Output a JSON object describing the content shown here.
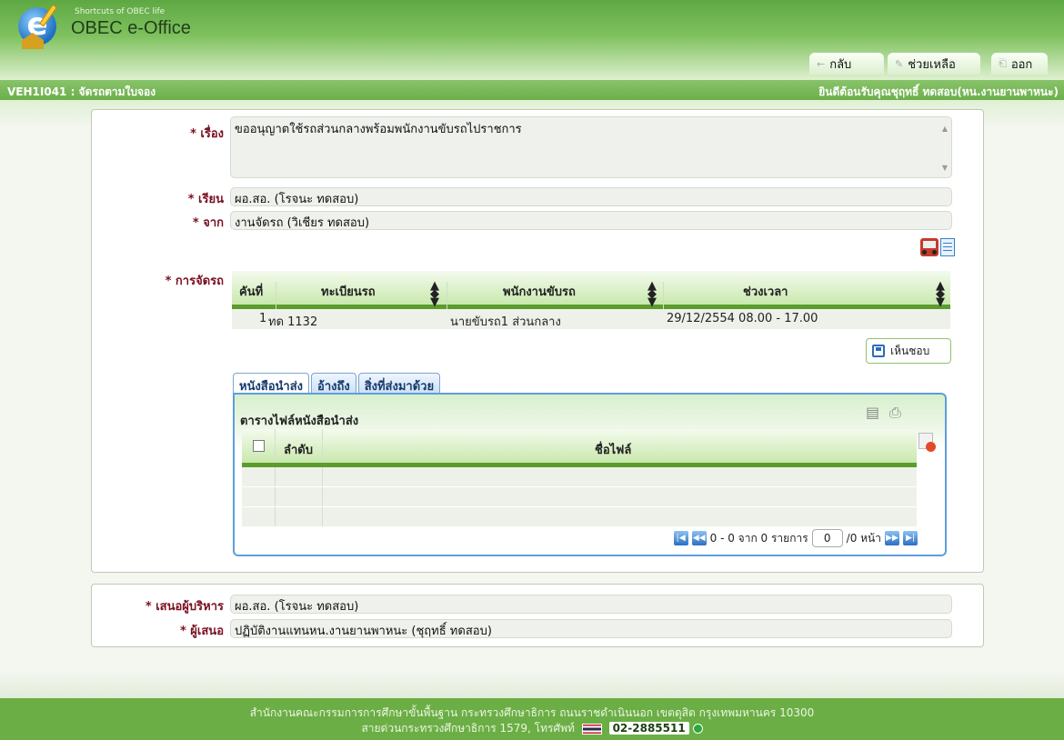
{
  "header": {
    "tagline": "Shortcuts of OBEC life",
    "app_name": "OBEC e-Office",
    "nav": {
      "back": "กลับ",
      "help": "ช่วยเหลือ",
      "logout": "ออก"
    }
  },
  "titlebar": {
    "page_code": "VEH1I041 : จัดรถตามใบจอง",
    "welcome": "ยินดีต้อนรับคุณชุฤทธิ์ ทดสอบ(หน.งานยานพาหนะ)"
  },
  "form": {
    "subject_label": "* เรื่อง",
    "subject_value": "ขออนุญาตใช้รถส่วนกลางพร้อมพนักงานขับรถไปราชการ",
    "to_label": "* เรียน",
    "to_value": "ผอ.สอ. (โรจนะ ทดสอบ)",
    "from_label": "* จาก",
    "from_value": "งานจัดรถ (วิเชียร ทดสอบ)",
    "assign_label": "* การจัดรถ",
    "save_button": "เห็นชอบ"
  },
  "vehicle_grid": {
    "headers": {
      "no": "คันที่",
      "plate": "ทะเบียนรถ",
      "driver": "พนักงานขับรถ",
      "period": "ช่วงเวลา"
    },
    "rows": [
      {
        "no": "1",
        "plate": "ทด 1132",
        "driver": "นายขับรถ1 ส่วนกลาง",
        "period": "29/12/2554 08.00 - 17.00"
      }
    ]
  },
  "tabs": [
    "หนังสือนำส่ง",
    "อ้างถึง",
    "สิ่งที่ส่งมาด้วย"
  ],
  "file_table": {
    "title": "ตารางไฟล์หนังสือนำส่ง",
    "headers": {
      "order": "ลำดับ",
      "filename": "ชื่อไฟล์"
    },
    "pager": {
      "summary": "0 - 0 จาก 0 รายการ",
      "page_value": "0",
      "page_suffix": "/0 หน้า"
    }
  },
  "approval": {
    "exec_label": "* เสนอผู้บริหาร",
    "exec_value": "ผอ.สอ. (โรจนะ ทดสอบ)",
    "proposer_label": "* ผู้เสนอ",
    "proposer_value": "ปฏิบัติงานแทนหน.งานยานพาหนะ (ชุฤทธิ์ ทดสอบ)"
  },
  "footer": {
    "line1": "สำนักงานคณะกรรมการการศึกษาขั้นพื้นฐาน กระทรวงศึกษาธิการ ถนนราชดำเนินนอก เขตดุสิต กรุงเทพมหานคร 10300",
    "line2": "สายด่วนกระทรวงศึกษาธิการ 1579, โทรศัพท์",
    "phone": "02-2885511"
  }
}
